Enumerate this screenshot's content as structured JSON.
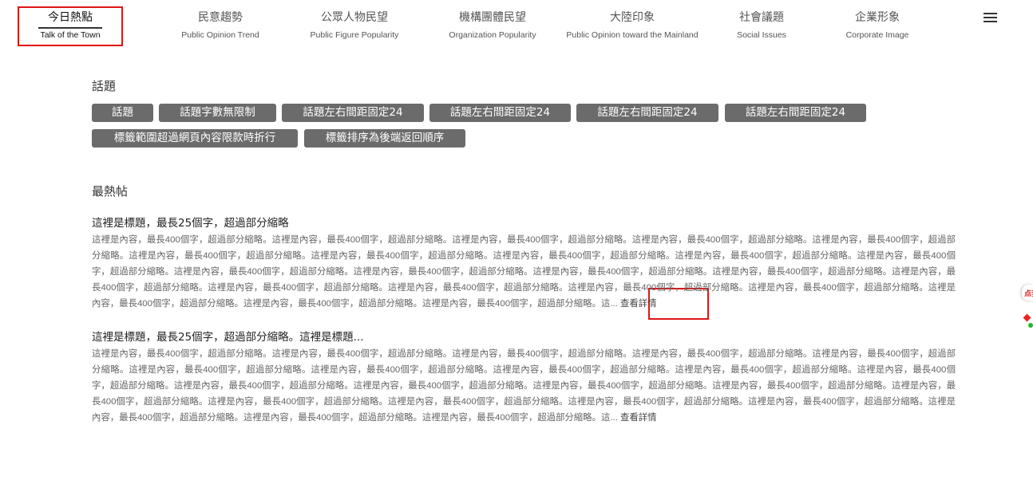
{
  "nav": {
    "items": [
      {
        "zh": "今日熱點",
        "en": "Talk of the Town"
      },
      {
        "zh": "民意趨勢",
        "en": "Public Opinion Trend"
      },
      {
        "zh": "公眾人物民望",
        "en": "Public Figure Popularity"
      },
      {
        "zh": "機構團體民望",
        "en": "Organization Popularity"
      },
      {
        "zh": "大陸印象",
        "en": "Public Opinion toward the Mainland"
      },
      {
        "zh": "社會議題",
        "en": "Social Issues"
      },
      {
        "zh": "企業形象",
        "en": "Corporate Image"
      }
    ],
    "menu_icon": "hamburger-menu-icon"
  },
  "topics": {
    "title": "話題",
    "tags": [
      "話題",
      "話題字數無限制",
      "話題左右間距固定24",
      "話題左右間距固定24",
      "話題左右間距固定24",
      "話題左右間距固定24",
      "標籤範圍超過網頁內容限款時折行",
      "標籤排序為後端返回順序"
    ]
  },
  "hot_posts": {
    "title": "最熱帖",
    "posts": [
      {
        "title": "這裡是標題，最長25個字，超過部分縮略",
        "body": "這裡是內容，最長400個字，超過部分縮略。這裡是內容，最長400個字，超過部分縮略。這裡是內容，最長400個字，超過部分縮略。這裡是內容，最長400個字，超過部分縮略。這裡是內容，最長400個字，超過部分縮略。這裡是內容，最長400個字，超過部分縮略。這裡是內容，最長400個字，超過部分縮略。這裡是內容，最長400個字，超過部分縮略。這裡是內容，最長400個字，超過部分縮略。這裡是內容，最長400個字，超過部分縮略。這裡是內容，最長400個字，超過部分縮略。這裡是內容，最長400個字，超過部分縮略。這裡是內容，最長400個字，超過部分縮略。這裡是內容，最長400個字，超過部分縮略。這裡是內容，最長400個字，超過部分縮略。這裡是內容，最長400個字，超過部分縮略。這裡是內容，最長400個字，超過部分縮略。這裡是內容，最長400個字，超過部分縮略。這裡是內容，最長400個字，超過部分縮略。這裡是內容，最長400個字，超過部分縮略。這裡是內容，最長400個字，超過部分縮略。這裡是內容，最長400個字，超過部分縮略。這...",
        "more": "查看詳情"
      },
      {
        "title": "這裡是標題，最長25個字，超過部分縮略。這裡是標題...",
        "body": "這裡是內容，最長400個字，超過部分縮略。這裡是內容，最長400個字，超過部分縮略。這裡是內容，最長400個字，超過部分縮略。這裡是內容，最長400個字，超過部分縮略。這裡是內容，最長400個字，超過部分縮略。這裡是內容，最長400個字，超過部分縮略。這裡是內容，最長400個字，超過部分縮略。這裡是內容，最長400個字，超過部分縮略。這裡是內容，最長400個字，超過部分縮略。這裡是內容，最長400個字，超過部分縮略。這裡是內容，最長400個字，超過部分縮略。這裡是內容，最長400個字，超過部分縮略。這裡是內容，最長400個字，超過部分縮略。這裡是內容，最長400個字，超過部分縮略。這裡是內容，最長400個字，超過部分縮略。這裡是內容，最長400個字，超過部分縮略。這裡是內容，最長400個字，超過部分縮略。這裡是內容，最長400個字，超過部分縮略。這裡是內容，最長400個字，超過部分縮略。這裡是內容，最長400個字，超過部分縮略。這裡是內容，最長400個字，超過部分縮略。這裡是內容，最長400個字，超過部分縮略。這...",
        "more": "查看詳情"
      }
    ]
  },
  "edge_widget": {
    "label": "点我"
  },
  "colors": {
    "tag_bg": "#6b6b6b",
    "annotation_red": "#e01414",
    "text": "#333333"
  }
}
